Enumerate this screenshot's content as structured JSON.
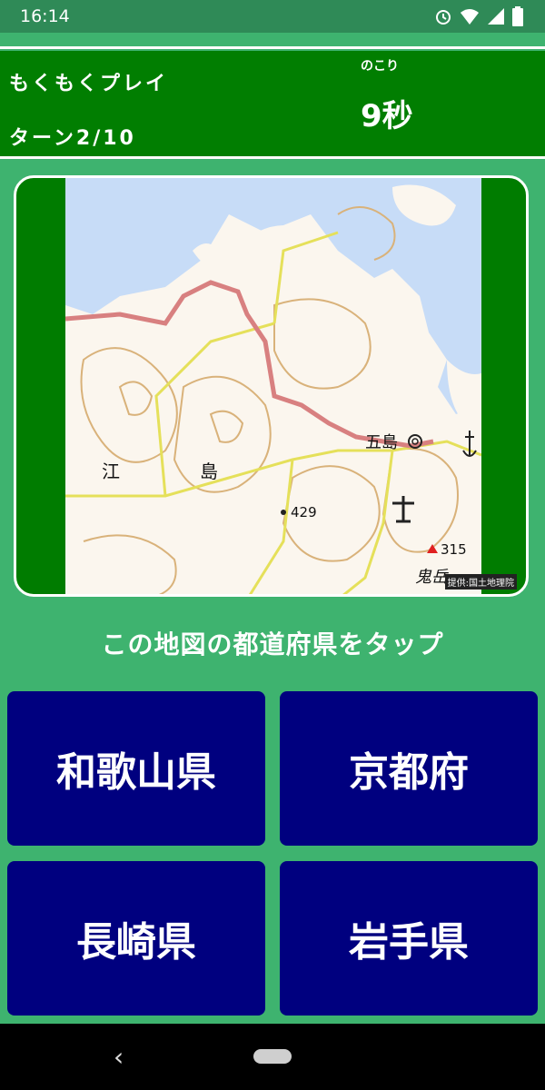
{
  "status_bar": {
    "time": "16:14",
    "icons": [
      "alarm-icon",
      "wifi-icon",
      "signal-icon",
      "battery-icon"
    ]
  },
  "header": {
    "mode": "もくもくプレイ",
    "turn": "ターン2/10",
    "remaining_label": "のこり",
    "remaining_value": "9秒"
  },
  "map": {
    "labels": {
      "goto": "五島",
      "e": "江",
      "shima": "島",
      "elev1": "429",
      "elev2": "315",
      "oni": "鬼岳"
    },
    "credit": "提供:国土地理院"
  },
  "instruction": "この地図の都道府県をタップ",
  "choices": [
    "和歌山県",
    "京都府",
    "長崎県",
    "岩手県"
  ],
  "colors": {
    "background": "#3eb36f",
    "header": "#017e01",
    "button": "#00007f"
  }
}
